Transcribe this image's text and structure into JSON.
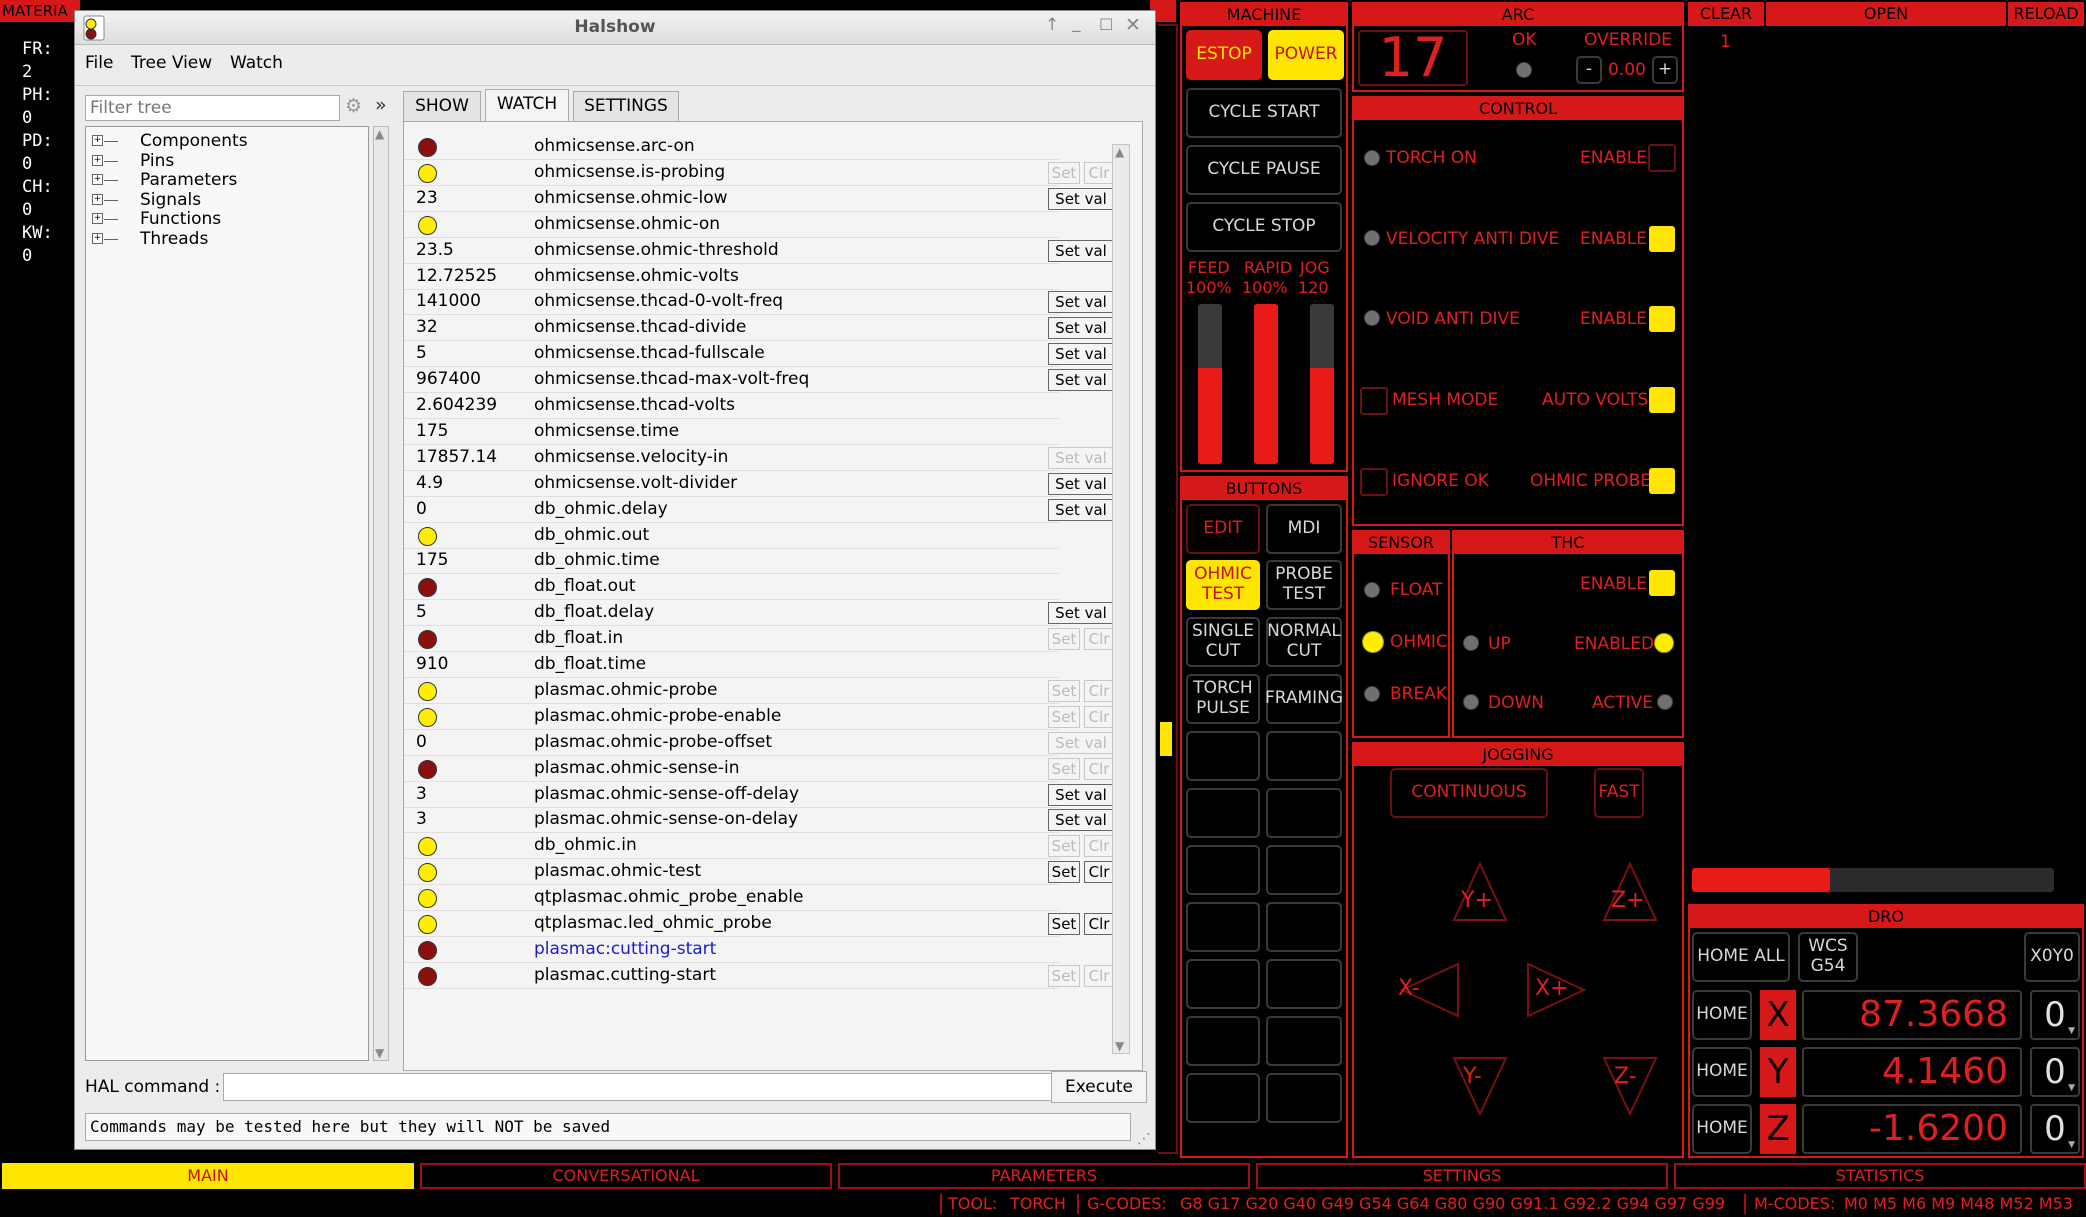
{
  "left_status": {
    "header": "MATERIA",
    "lines": [
      "FR: 2",
      "PH: 0",
      "PD: 0",
      "CH: 0",
      "KW: 0"
    ]
  },
  "halshow": {
    "title": "Halshow",
    "menu": [
      "File",
      "Tree View",
      "Watch"
    ],
    "filter_placeholder": "Filter tree",
    "expand_glyph": "»",
    "tree": [
      "Components",
      "Pins",
      "Parameters",
      "Signals",
      "Functions",
      "Threads"
    ],
    "tabs": [
      "SHOW",
      "WATCH",
      "SETTINGS"
    ],
    "active_tab": "WATCH",
    "set_val_label": "Set val",
    "set_label": "Set",
    "clr_label": "Clr",
    "watch_rows": [
      {
        "kind": "led",
        "led": "red",
        "name": "ohmicsense.arc-on",
        "btn": "none"
      },
      {
        "kind": "led",
        "led": "yellow",
        "name": "ohmicsense.is-probing",
        "btn": "setclr-dis"
      },
      {
        "kind": "val",
        "value": "23",
        "name": "ohmicsense.ohmic-low",
        "btn": "setval"
      },
      {
        "kind": "led",
        "led": "yellow",
        "name": "ohmicsense.ohmic-on",
        "btn": "none"
      },
      {
        "kind": "val",
        "value": "23.5",
        "name": "ohmicsense.ohmic-threshold",
        "btn": "setval"
      },
      {
        "kind": "val",
        "value": "12.72525",
        "name": "ohmicsense.ohmic-volts",
        "btn": "none"
      },
      {
        "kind": "val",
        "value": "141000",
        "name": "ohmicsense.thcad-0-volt-freq",
        "btn": "setval"
      },
      {
        "kind": "val",
        "value": "32",
        "name": "ohmicsense.thcad-divide",
        "btn": "setval"
      },
      {
        "kind": "val",
        "value": "5",
        "name": "ohmicsense.thcad-fullscale",
        "btn": "setval"
      },
      {
        "kind": "val",
        "value": "967400",
        "name": "ohmicsense.thcad-max-volt-freq",
        "btn": "setval"
      },
      {
        "kind": "val",
        "value": "2.604239",
        "name": "ohmicsense.thcad-volts",
        "btn": "none"
      },
      {
        "kind": "val",
        "value": "175",
        "name": "ohmicsense.time",
        "btn": "none"
      },
      {
        "kind": "val",
        "value": "17857.14",
        "name": "ohmicsense.velocity-in",
        "btn": "setval-dis"
      },
      {
        "kind": "val",
        "value": "4.9",
        "name": "ohmicsense.volt-divider",
        "btn": "setval"
      },
      {
        "kind": "val",
        "value": "0",
        "name": "db_ohmic.delay",
        "btn": "setval"
      },
      {
        "kind": "led",
        "led": "yellow",
        "name": "db_ohmic.out",
        "btn": "none"
      },
      {
        "kind": "val",
        "value": "175",
        "name": "db_ohmic.time",
        "btn": "none"
      },
      {
        "kind": "led",
        "led": "red",
        "name": "db_float.out",
        "btn": "none"
      },
      {
        "kind": "val",
        "value": "5",
        "name": "db_float.delay",
        "btn": "setval"
      },
      {
        "kind": "led",
        "led": "red",
        "name": "db_float.in",
        "btn": "setclr-dis"
      },
      {
        "kind": "val",
        "value": "910",
        "name": "db_float.time",
        "btn": "none"
      },
      {
        "kind": "led",
        "led": "yellow",
        "name": "plasmac.ohmic-probe",
        "btn": "setclr-dis"
      },
      {
        "kind": "led",
        "led": "yellow",
        "name": "plasmac.ohmic-probe-enable",
        "btn": "setclr-dis"
      },
      {
        "kind": "val",
        "value": "0",
        "name": "plasmac.ohmic-probe-offset",
        "btn": "setval-dis"
      },
      {
        "kind": "led",
        "led": "red",
        "name": "plasmac.ohmic-sense-in",
        "btn": "setclr-dis"
      },
      {
        "kind": "val",
        "value": "3",
        "name": "plasmac.ohmic-sense-off-delay",
        "btn": "setval"
      },
      {
        "kind": "val",
        "value": "3",
        "name": "plasmac.ohmic-sense-on-delay",
        "btn": "setval"
      },
      {
        "kind": "led",
        "led": "yellow",
        "name": "db_ohmic.in",
        "btn": "setclr-dis"
      },
      {
        "kind": "led",
        "led": "yellow",
        "name": "plasmac.ohmic-test",
        "btn": "setclr"
      },
      {
        "kind": "led",
        "led": "yellow",
        "name": "qtplasmac.ohmic_probe_enable",
        "btn": "none"
      },
      {
        "kind": "led",
        "led": "yellow",
        "name": "qtplasmac.led_ohmic_probe",
        "btn": "setclr"
      },
      {
        "kind": "led",
        "led": "red",
        "name": "plasmac:cutting-start",
        "btn": "none",
        "link": true
      },
      {
        "kind": "led",
        "led": "red",
        "name": "plasmac.cutting-start",
        "btn": "setclr-dis"
      }
    ],
    "hal_command_label": "HAL command :",
    "hal_command_value": "",
    "execute_label": "Execute",
    "status_text": "Commands may be tested here but they will NOT be saved"
  },
  "machine": {
    "header": "MACHINE",
    "estop": "ESTOP",
    "power": "POWER",
    "cycle_start": "CYCLE START",
    "cycle_pause": "CYCLE PAUSE",
    "cycle_stop": "CYCLE STOP",
    "sliders": [
      {
        "label": "FEED",
        "value": "100%",
        "level": 0.6
      },
      {
        "label": "RAPID",
        "value": "100%",
        "level": 1.0
      },
      {
        "label": "JOG",
        "value": "120",
        "level": 0.6
      }
    ]
  },
  "buttons_panel": {
    "header": "BUTTONS",
    "edit": "EDIT",
    "mdi": "MDI",
    "ohmic_test": "OHMIC\nTEST",
    "probe_test": "PROBE\nTEST",
    "single_cut": "SINGLE\nCUT",
    "normal_cut": "NORMAL\nCUT",
    "torch_pulse": "TORCH\nPULSE",
    "framing": "FRAMING"
  },
  "arc": {
    "header": "ARC",
    "voltage": "17",
    "ok_label": "OK",
    "override_label": "OVERRIDE",
    "minus": "-",
    "override_value": "0.00",
    "plus": "+"
  },
  "control": {
    "header": "CONTROL",
    "torch_on": "TORCH ON",
    "velocity_anti_dive": "VELOCITY ANTI DIVE",
    "void_anti_dive": "VOID ANTI DIVE",
    "mesh_mode": "MESH MODE",
    "ignore_ok": "IGNORE OK",
    "enable": "ENABLE",
    "auto_volts": "AUTO VOLTS",
    "ohmic_probe": "OHMIC PROBE"
  },
  "sensor": {
    "header": "SENSOR",
    "float": "FLOAT",
    "ohmic": "OHMIC",
    "break": "BREAK"
  },
  "thc": {
    "header": "THC",
    "enable": "ENABLE",
    "up": "UP",
    "enabled": "ENABLED",
    "down": "DOWN",
    "active": "ACTIVE"
  },
  "jogging": {
    "header": "JOGGING",
    "continuous": "CONTINUOUS",
    "fast": "FAST",
    "y_plus": "Y+",
    "z_plus": "Z+",
    "x_minus": "X-",
    "x_plus": "X+",
    "y_minus": "Y-",
    "z_minus": "Z-"
  },
  "gcode": {
    "clear": "CLEAR",
    "open": "OPEN",
    "reload": "RELOAD",
    "line_number": "1",
    "progress": 0.38
  },
  "dro": {
    "header": "DRO",
    "home_all": "HOME ALL",
    "wcs": "WCS\nG54",
    "x0y0": "X0Y0",
    "home": "HOME",
    "axes": [
      {
        "axis": "X",
        "value": "87.3668",
        "offset": "0"
      },
      {
        "axis": "Y",
        "value": "4.1460",
        "offset": "0"
      },
      {
        "axis": "Z",
        "value": "-1.6200",
        "offset": "0"
      }
    ]
  },
  "bottom_tabs": [
    "MAIN",
    "CONVERSATIONAL",
    "PARAMETERS",
    "SETTINGS",
    "STATISTICS"
  ],
  "active_bottom_tab": "MAIN",
  "status_bar": {
    "tool_label": "TOOL:",
    "tool": "TORCH",
    "gcodes_label": "G-CODES:",
    "gcodes": "G8 G17 G20 G40 G49 G54 G64 G80 G90 G91.1 G92.2 G94 G97 G99",
    "mcodes_label": "M-CODES:",
    "mcodes": "M0 M5 M6 M9 M48 M52 M53"
  },
  "colors": {
    "accent_red": "#d61818",
    "yellow": "#ffe600",
    "led_off": "#707070"
  }
}
